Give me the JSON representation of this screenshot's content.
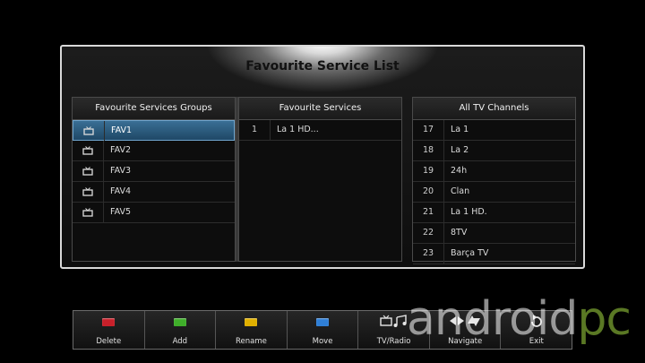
{
  "dialog": {
    "title": "Favourite Service List"
  },
  "groups": {
    "header": "Favourite Services Groups",
    "items": [
      "FAV1",
      "FAV2",
      "FAV3",
      "FAV4",
      "FAV5"
    ],
    "selected": "FAV1"
  },
  "services": {
    "header": "Favourite Services",
    "items": [
      {
        "num": "1",
        "name": "La 1 HD..."
      }
    ]
  },
  "channels": {
    "header": "All TV Channels",
    "items": [
      {
        "num": "17",
        "name": "La 1"
      },
      {
        "num": "18",
        "name": "La 2"
      },
      {
        "num": "19",
        "name": "24h"
      },
      {
        "num": "20",
        "name": "Clan"
      },
      {
        "num": "21",
        "name": "La 1 HD."
      },
      {
        "num": "22",
        "name": "8TV"
      },
      {
        "num": "23",
        "name": "Barça TV"
      }
    ]
  },
  "bottombar": {
    "delete": {
      "label": "Delete",
      "color": "#c8202a",
      "icon": "red-key-icon"
    },
    "add": {
      "label": "Add",
      "color": "#3fae2a",
      "icon": "green-key-icon"
    },
    "rename": {
      "label": "Rename",
      "color": "#e0b000",
      "icon": "yellow-key-icon"
    },
    "move": {
      "label": "Move",
      "color": "#2f7fd6",
      "icon": "blue-key-icon"
    },
    "tvradio": {
      "label": "TV/Radio",
      "icon": "tv-radio-icon"
    },
    "navigate": {
      "label": "Navigate",
      "icon": "navigate-arrows-icon"
    },
    "exit": {
      "label": "Exit",
      "icon": "exit-icon"
    }
  },
  "watermark": {
    "text": "android",
    "accent": "pc"
  }
}
